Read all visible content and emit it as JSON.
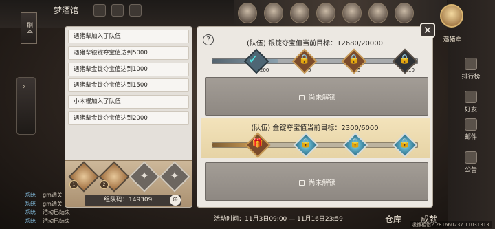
{
  "header": {
    "back_label": "刷本",
    "title": "一梦酒馆",
    "top_icons": [
      "",
      "",
      "",
      ""
    ]
  },
  "event_log": {
    "items": [
      "遇猪辈加入了队伍",
      "遇猪辈银锭夺宝值达到5000",
      "遇猪辈金锭夺宝值达到1000",
      "遇猪辈金锭夺宝值达到1500",
      "小木棍加入了队伍",
      "遇猪辈金锭夺宝值达到2000"
    ]
  },
  "team": {
    "members": [
      {
        "state": "filled",
        "level": "1"
      },
      {
        "state": "filled",
        "level": "2"
      },
      {
        "state": "empty"
      },
      {
        "state": "empty"
      }
    ],
    "code_label": "组队码：149309"
  },
  "silver_goal": {
    "title": "(队伍) 银锭夺宝值当前目标：12680/20000",
    "progress": 0.32,
    "rewards": [
      {
        "type": "claimed",
        "count": "200"
      },
      {
        "type": "gift",
        "count": "5"
      },
      {
        "type": "gift",
        "count": "5"
      },
      {
        "type": "dark",
        "count": "10"
      }
    ],
    "locked_label": "尚未解锁"
  },
  "gold_goal": {
    "title": "(队伍) 金锭夺宝值当前目标：2300/6000",
    "progress": 0.2,
    "rewards": [
      {
        "type": "gift",
        "count": ""
      },
      {
        "type": "silver",
        "count": ""
      },
      {
        "type": "silver",
        "count": ""
      },
      {
        "type": "silver",
        "count": ""
      }
    ],
    "locked_label": "尚未解锁"
  },
  "right_rail": {
    "leader_label": "遇猪辈",
    "items": [
      "排行榜",
      "好友",
      "邮件",
      "公告"
    ]
  },
  "chat": {
    "lines": [
      {
        "sys": "系统",
        "text": "gm通关"
      },
      {
        "sys": "系统",
        "text": "gm通关"
      },
      {
        "sys": "系统",
        "text": "活动已结束"
      },
      {
        "sys": "系统",
        "text": "活动已结束"
      }
    ]
  },
  "footer": {
    "activity_time": "活动时间：11月3日09:00 — 11月16日23:59",
    "btn_warehouse": "仓库",
    "btn_achievement": "成就",
    "watermark": "吸猴相惜2 281660237 11031313"
  },
  "colors": {
    "panel_bg": "#ece8e2",
    "accent_check": "#51e3e1",
    "gold_band": "#f3e3bb"
  }
}
